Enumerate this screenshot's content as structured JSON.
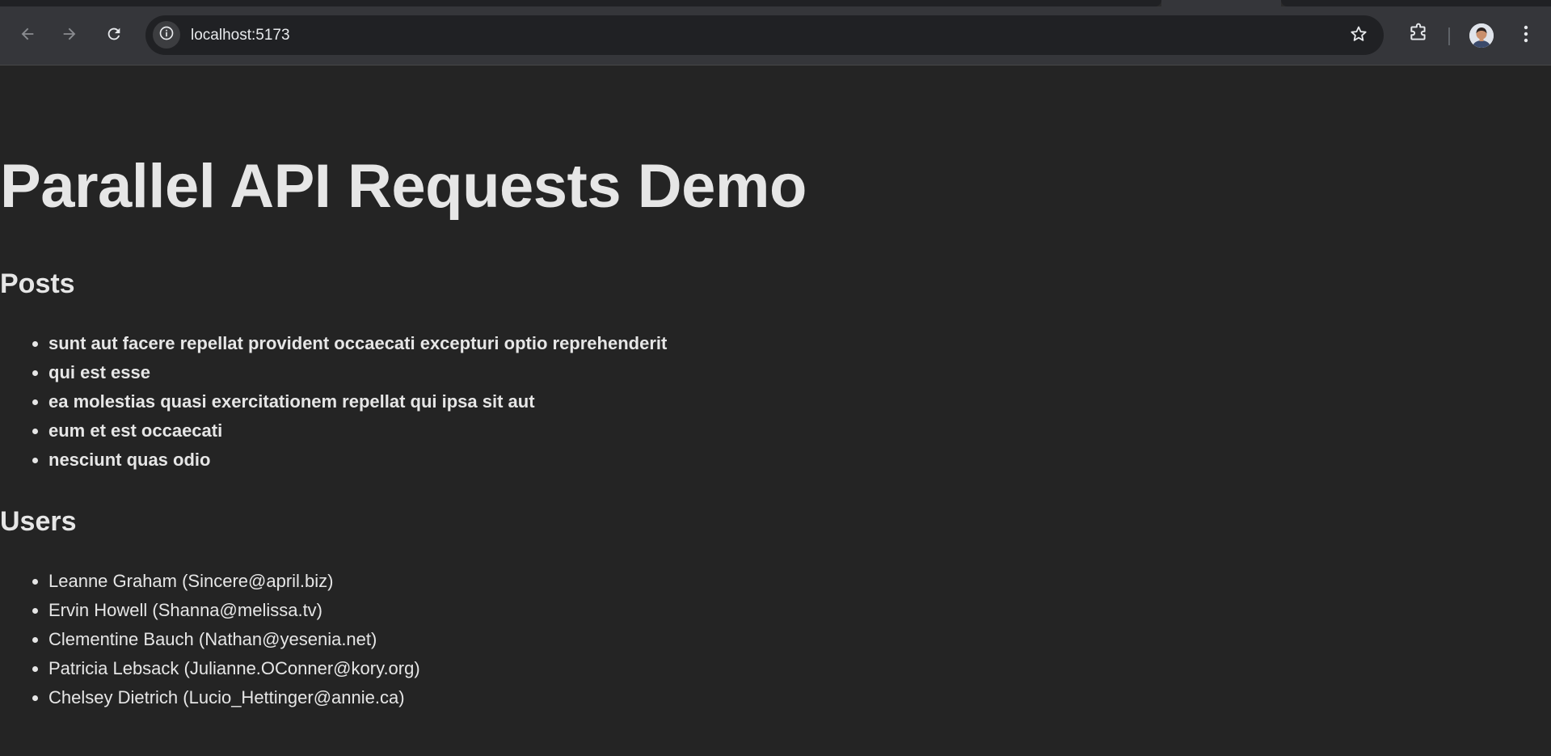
{
  "browser": {
    "url": "localhost:5173"
  },
  "icons": {
    "back": "arrow-left-icon",
    "forward": "arrow-right-icon",
    "reload": "reload-icon",
    "site_info": "info-icon",
    "bookmark": "star-icon",
    "extensions": "puzzle-icon",
    "profile": "avatar",
    "menu": "kebab-menu-icon"
  },
  "colors": {
    "page_background": "#242424",
    "toolbar_background": "#35363a",
    "omnibox_background": "#202124",
    "text": "#e6e6e6"
  },
  "page": {
    "title": "Parallel API Requests Demo",
    "posts": {
      "heading": "Posts",
      "items": [
        "sunt aut facere repellat provident occaecati excepturi optio reprehenderit",
        "qui est esse",
        "ea molestias quasi exercitationem repellat qui ipsa sit aut",
        "eum et est occaecati",
        "nesciunt quas odio"
      ]
    },
    "users": {
      "heading": "Users",
      "items": [
        "Leanne Graham (Sincere@april.biz)",
        "Ervin Howell (Shanna@melissa.tv)",
        "Clementine Bauch (Nathan@yesenia.net)",
        "Patricia Lebsack (Julianne.OConner@kory.org)",
        "Chelsey Dietrich (Lucio_Hettinger@annie.ca)"
      ]
    }
  }
}
